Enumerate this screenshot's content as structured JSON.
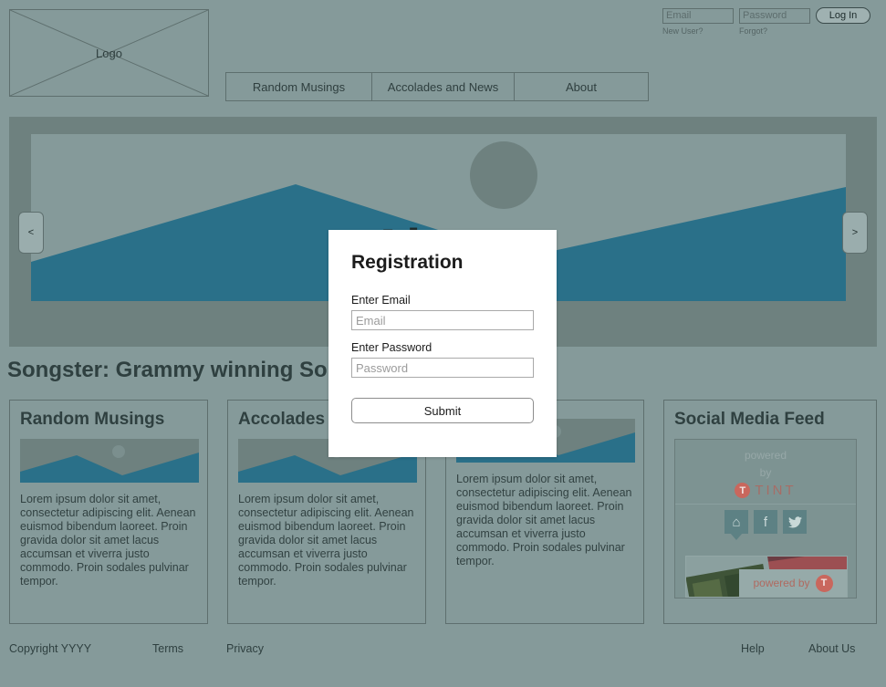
{
  "header": {
    "logo_label": "Logo",
    "nav": [
      {
        "label": "Random Musings"
      },
      {
        "label": "Accolades and News"
      },
      {
        "label": "About"
      }
    ]
  },
  "login": {
    "email_placeholder": "Email",
    "password_placeholder": "Password",
    "login_label": "Log In",
    "new_user_label": "New User?",
    "forgot_label": "Forgot?"
  },
  "hero": {
    "title": "About",
    "prev_label": "<",
    "next_label": ">"
  },
  "section": {
    "title": "Songster: Grammy winning So"
  },
  "cards": [
    {
      "title": "Random Musings",
      "text": "Lorem ipsum dolor sit amet, consectetur adipiscing elit. Aenean euismod bibendum laoreet. Proin gravida dolor sit amet lacus accumsan et viverra justo commodo. Proin sodales pulvinar tempor."
    },
    {
      "title": "Accolades",
      "text": "Lorem ipsum dolor sit amet, consectetur adipiscing elit. Aenean euismod bibendum laoreet. Proin gravida dolor sit amet lacus accumsan et viverra justo commodo. Proin sodales pulvinar tempor."
    },
    {
      "title": "",
      "text": "Lorem ipsum dolor sit amet, consectetur adipiscing elit. Aenean euismod bibendum laoreet. Proin gravida dolor sit amet lacus accumsan et viverra justo commodo. Proin sodales pulvinar tempor."
    }
  ],
  "social": {
    "title": "Social Media Feed",
    "powered_line1": "powered",
    "powered_line2": "by",
    "brand_badge": "T",
    "brand_name": "TINT",
    "icons": [
      {
        "name": "home-icon",
        "glyph": "⌂"
      },
      {
        "name": "facebook-icon",
        "glyph": "f"
      },
      {
        "name": "twitter-icon",
        "glyph": "ᵀ"
      }
    ],
    "photo_caption": "powered by",
    "photo_badge": "T"
  },
  "footer": {
    "copyright": "Copyright YYYY",
    "terms": "Terms",
    "privacy": "Privacy",
    "help": "Help",
    "about_us": "About Us"
  },
  "modal": {
    "title": "Registration",
    "email_label": "Enter Email",
    "email_placeholder": "Email",
    "password_label": "Enter Password",
    "password_placeholder": "Password",
    "submit_label": "Submit"
  },
  "colors": {
    "page_bg": "#859a9a",
    "hero_bg": "#6e817f",
    "accent_teal": "#2a7089",
    "outline": "#5e6f6e",
    "text": "#2f4040",
    "tint_red": "#c9675d"
  }
}
